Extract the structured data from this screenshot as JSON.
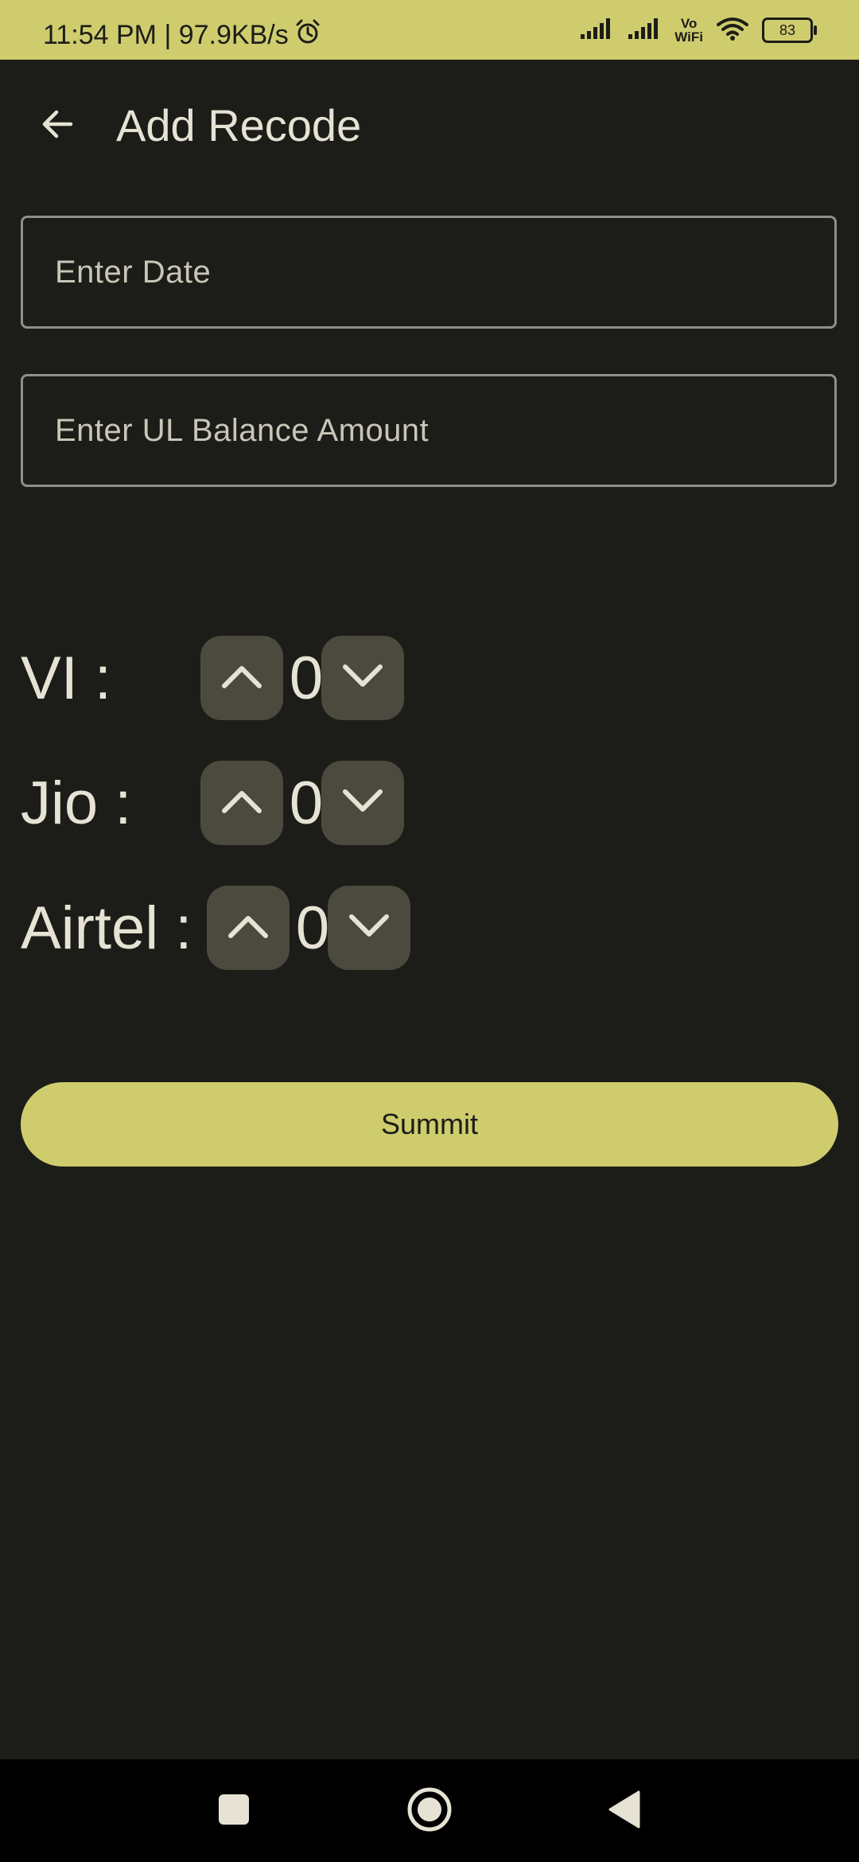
{
  "status_bar": {
    "time_speed": "11:54 PM | 97.9KB/s",
    "vowifi_top": "Vo",
    "vowifi_bottom": "WiFi",
    "battery": "83",
    "icons": [
      "alarm-icon",
      "signal-icon",
      "signal-icon",
      "wifi-icon",
      "battery-icon"
    ]
  },
  "app_bar": {
    "title": "Add Recode",
    "back_icon": "arrow-left-icon"
  },
  "form": {
    "date_placeholder": "Enter Date",
    "date_value": "",
    "balance_placeholder": "Enter UL Balance Amount",
    "balance_value": ""
  },
  "counters": [
    {
      "label": "VI :",
      "value": "0"
    },
    {
      "label": "Jio :",
      "value": "0"
    },
    {
      "label": "Airtel :",
      "value": "0"
    }
  ],
  "submit_label": "Summit",
  "nav_bar": {
    "icons": [
      "recents-square-icon",
      "home-circle-icon",
      "back-triangle-icon"
    ]
  },
  "colors": {
    "background": "#1c1d18",
    "accent": "#cfcc6e",
    "stepper_bg": "#4c4a3e",
    "text": "#e6e3d5"
  }
}
